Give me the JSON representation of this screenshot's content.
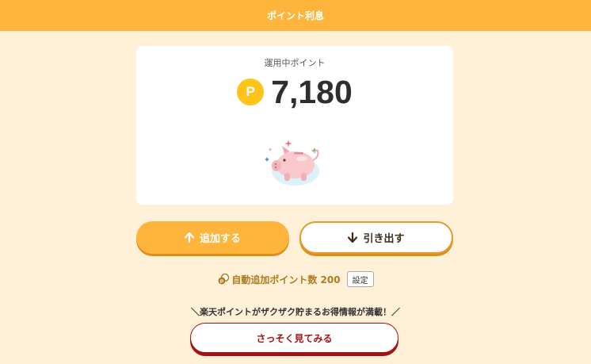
{
  "header": {
    "title": "ポイント利息"
  },
  "card": {
    "label": "運用中ポイント",
    "coin_symbol": "P",
    "balance": "7,180",
    "illustration": "piggy-bank"
  },
  "actions": {
    "add_label": "追加する",
    "add_icon": "arrow-up-icon",
    "withdraw_label": "引き出す",
    "withdraw_icon": "arrow-down-icon"
  },
  "auto_add": {
    "text": "自動追加ポイント数 200",
    "icon": "coin-stack-icon",
    "setting_label": "設定"
  },
  "promo": {
    "text": "＼楽天ポイントがザクザク貯まるお得情報が満載！／",
    "button_label": "さっそく見てみる"
  },
  "colors": {
    "header": "#FFB53C",
    "background": "#FFF0D8",
    "coin": "#FFC41A",
    "accent_text": "#B07A1E",
    "promo_button": "#A01414"
  }
}
